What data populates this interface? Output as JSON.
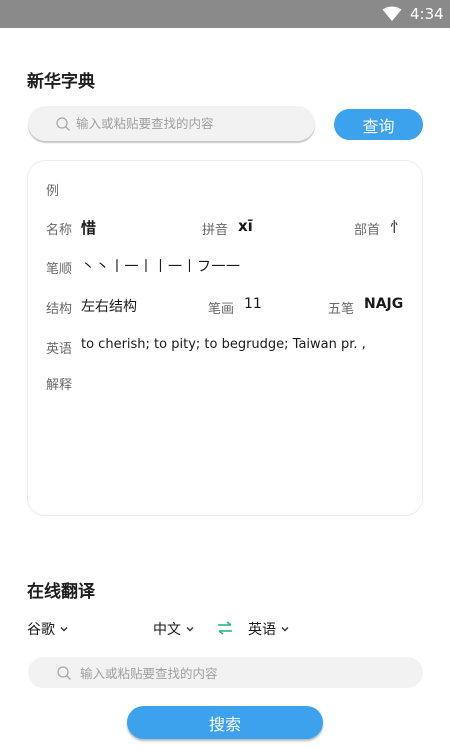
{
  "status_bar": {
    "time": "4:34"
  },
  "dictionary": {
    "title": "新华字典",
    "search_placeholder": "输入或粘贴要查找的内容",
    "query_label": "查询",
    "card": {
      "example_label": "例",
      "name_label": "名称",
      "name_value": "惜",
      "pinyin_label": "拼音",
      "pinyin_value": "xī",
      "radical_label": "部首",
      "radical_value": "忄",
      "stroke_order_label": "笔顺",
      "stroke_order_value": "丶丶丨一丨丨一丨フ一一",
      "structure_label": "结构",
      "structure_value": "左右结构",
      "strokes_label": "笔画",
      "strokes_value": "11",
      "wubi_label": "五笔",
      "wubi_value": "NAJG",
      "english_label": "英语",
      "english_value": "to cherish; to pity; to begrudge; Taiwan pr. ,",
      "explanation_label": "解释"
    }
  },
  "translation": {
    "title": "在线翻译",
    "engine": "谷歌",
    "source_lang": "中文",
    "target_lang": "英语",
    "search_placeholder": "输入或粘贴要查找的内容",
    "search_label": "搜索"
  },
  "colors": {
    "accent": "#3da2ee",
    "swap": "#2fb38a",
    "status_bar": "#8a8a8a"
  },
  "icons": {
    "wifi": "wifi-icon",
    "search": "search-icon",
    "caret": "chevron-down-icon",
    "swap": "swap-arrows-icon"
  }
}
